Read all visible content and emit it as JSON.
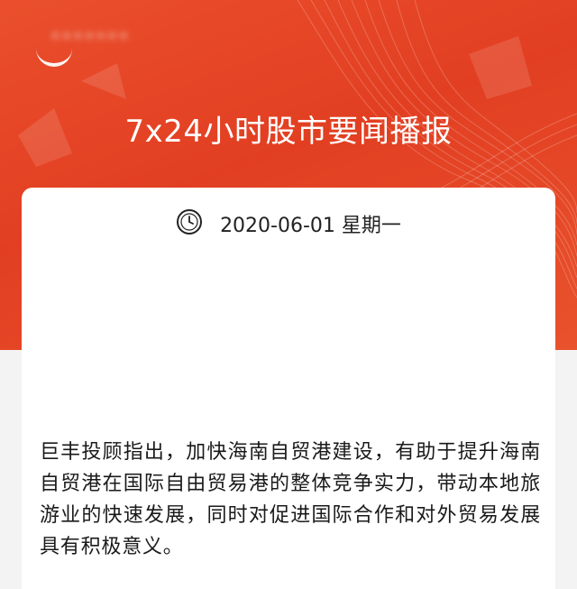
{
  "header": {
    "blurred_account_name": "•••••••",
    "title": "7x24小时股市要闻播报"
  },
  "card": {
    "clock_icon": "clock-icon",
    "date": "2020-06-01 星期一",
    "content": "巨丰投顾指出，加快海南自贸港建设，有助于提升海南自贸港在国际自由贸易港的整体竞争实力，带动本地旅游业的快速发展，同时对促进国际合作和对外贸易发展具有积极意义。"
  },
  "colors": {
    "hero_red": "#e23f22",
    "hero_orange": "#ea4f2c",
    "background": "#f3f3f3",
    "card": "#ffffff"
  }
}
